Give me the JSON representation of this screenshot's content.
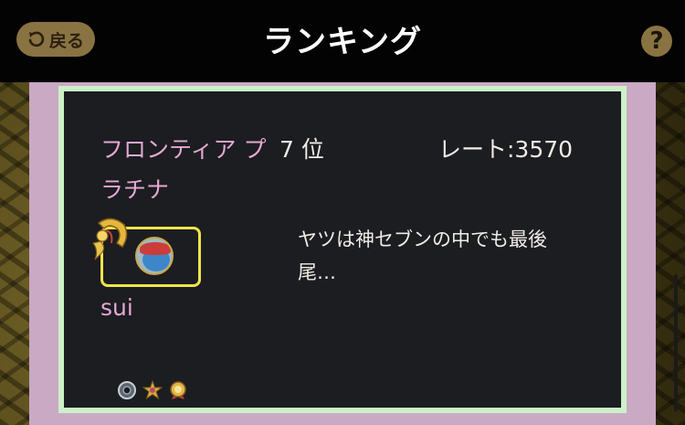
{
  "header": {
    "back_label": "戻る",
    "title": "ランキング",
    "help_label": "?"
  },
  "entry": {
    "team_name": "フロンティア プラチナ",
    "rank": "7 位",
    "rate": "レート:3570",
    "player_name": "sui",
    "comment": "ヤツは神セブンの中でも最後尾…",
    "badges": [
      "silver-ring-badge",
      "gold-star-badge",
      "gold-medal-badge"
    ]
  },
  "colors": {
    "header_bg": "#030303",
    "card_border": "#ccf0c8",
    "card_bg": "#1b1d21",
    "pink_frame": "#c9a9c3",
    "accent_gold": "#8a7342",
    "team_text": "#e6a8d2",
    "avatar_border": "#f0e34a"
  }
}
